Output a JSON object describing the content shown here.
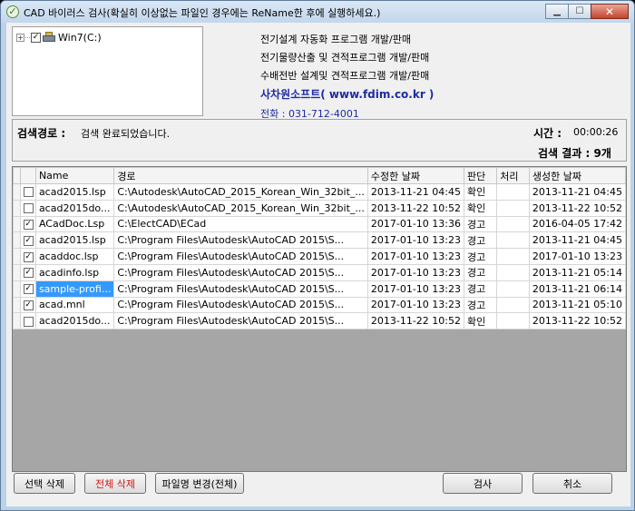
{
  "window": {
    "title": "CAD 바이러스 검사(확실히 이상없는 파일인 경우에는 ReName한 후에 실행하세요.)"
  },
  "tree": {
    "root_label": "Win7(C:)",
    "expander": "+",
    "checked": true
  },
  "info": {
    "line1": "전기설계 자동화 프로그램 개발/판매",
    "line2": "전기물량산출 및 견적프로그램 개발/판매",
    "line3": "수배전반 설계및 견적프로그램 개발/판매",
    "company": "사차원소프트( www.fdim.co.kr )",
    "phone": "전화 : 031-712-4001"
  },
  "status": {
    "path_label": "검색경로 :",
    "path_value": "검색 완료되었습니다.",
    "time_label": "시간 :",
    "time_value": "00:00:26",
    "result": "검색 결과 : 9개"
  },
  "table": {
    "columns": [
      "Name",
      "경로",
      "수정한 날짜",
      "판단",
      "처리",
      "생성한 날짜"
    ],
    "rows": [
      {
        "checked": false,
        "name": "acad2015.lsp",
        "path": "C:\\Autodesk\\AutoCAD_2015_Korean_Win_32bit_...",
        "modified": "2013-11-21 04:45",
        "judge": "확인",
        "action": "",
        "created": "2013-11-21 04:45"
      },
      {
        "checked": false,
        "name": "acad2015do...",
        "path": "C:\\Autodesk\\AutoCAD_2015_Korean_Win_32bit_...",
        "modified": "2013-11-22 10:52",
        "judge": "확인",
        "action": "",
        "created": "2013-11-22 10:52"
      },
      {
        "checked": true,
        "name": "ACadDoc.Lsp",
        "path": "C:\\ElectCAD\\ECad",
        "modified": "2017-01-10 13:36",
        "judge": "경고",
        "action": "",
        "created": "2016-04-05 17:42"
      },
      {
        "checked": true,
        "name": "acad2015.lsp",
        "path": "C:\\Program Files\\Autodesk\\AutoCAD 2015\\S...",
        "modified": "2017-01-10 13:23",
        "judge": "경고",
        "action": "",
        "created": "2013-11-21 04:45"
      },
      {
        "checked": true,
        "name": "acaddoc.lsp",
        "path": "C:\\Program Files\\Autodesk\\AutoCAD 2015\\S...",
        "modified": "2017-01-10 13:23",
        "judge": "경고",
        "action": "",
        "created": "2017-01-10 13:23"
      },
      {
        "checked": true,
        "name": "acadinfo.lsp",
        "path": "C:\\Program Files\\Autodesk\\AutoCAD 2015\\S...",
        "modified": "2017-01-10 13:23",
        "judge": "경고",
        "action": "",
        "created": "2013-11-21 05:14"
      },
      {
        "checked": true,
        "name": "sample-profi...",
        "path": "C:\\Program Files\\Autodesk\\AutoCAD 2015\\S...",
        "modified": "2017-01-10 13:23",
        "judge": "경고",
        "action": "",
        "created": "2013-11-21 06:14",
        "selected": true
      },
      {
        "checked": true,
        "name": "acad.mnl",
        "path": "C:\\Program Files\\Autodesk\\AutoCAD 2015\\S...",
        "modified": "2017-01-10 13:23",
        "judge": "경고",
        "action": "",
        "created": "2013-11-21 05:10"
      },
      {
        "checked": false,
        "name": "acad2015do...",
        "path": "C:\\Program Files\\Autodesk\\AutoCAD 2015\\S...",
        "modified": "2013-11-22 10:52",
        "judge": "확인",
        "action": "",
        "created": "2013-11-22 10:52"
      }
    ]
  },
  "buttons": {
    "delete_selected": "선택 삭제",
    "delete_all": "전체 삭제",
    "rename_all": "파일명 변경(전체)",
    "scan": "검사",
    "cancel": "취소"
  },
  "colors": {
    "warning_text": "#d41313",
    "company_text": "#1e2ca0",
    "selection": "#3399ff"
  }
}
